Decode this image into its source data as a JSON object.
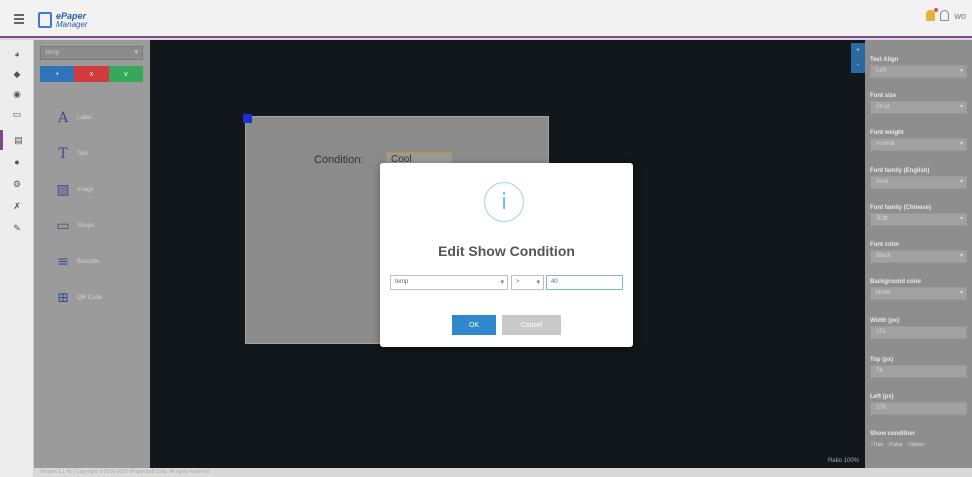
{
  "app": {
    "logo_line1": "ePaper",
    "logo_line2": "Manager",
    "user_label": "wo"
  },
  "rail": {
    "icons": [
      "dashboard-icon",
      "tag-icon",
      "globe-icon",
      "monitor-icon",
      "template-icon",
      "users-icon",
      "gear-icon",
      "tools-icon",
      "wrench-icon"
    ]
  },
  "toolbox": {
    "select_value": "temp",
    "buttons": [
      {
        "label": "+",
        "color": "#2f73b9"
      },
      {
        "label": "x",
        "color": "#d23b3b"
      },
      {
        "label": "v",
        "color": "#36a85a"
      }
    ],
    "tools": [
      {
        "icon": "A",
        "label": "Label"
      },
      {
        "icon": "T",
        "label": "Text"
      },
      {
        "icon": "▨",
        "label": "Image"
      },
      {
        "icon": "▭",
        "label": "Shape"
      },
      {
        "icon": "≡",
        "label": "Barcode"
      },
      {
        "icon": "⊞",
        "label": "QR Code"
      }
    ]
  },
  "canvas": {
    "condition_label": "Condition:",
    "condition_value": "Cool",
    "zoom_label": "Ratio 100%",
    "side_buttons": [
      "+",
      "-"
    ]
  },
  "modal": {
    "icon": "i",
    "title": "Edit Show Condition",
    "field1": "temp",
    "field2": ">",
    "field3": "40",
    "ok_label": "OK",
    "cancel_label": "Cancel"
  },
  "properties": {
    "text_align": {
      "label": "Text Align",
      "value": "Left"
    },
    "font_size": {
      "label": "Font size",
      "value": "24 pt"
    },
    "font_weight": {
      "label": "Font weight",
      "value": "normal"
    },
    "font_family_en": {
      "label": "Font family (English)",
      "value": "Arial"
    },
    "font_family_cn": {
      "label": "Font family (Chinese)",
      "value": "宋体"
    },
    "font_color": {
      "label": "Font color",
      "value": "Black"
    },
    "bg_color": {
      "label": "Background color",
      "value": "None"
    },
    "width": {
      "label": "Width (px)",
      "value": "151"
    },
    "top": {
      "label": "Top (px)",
      "value": "76"
    },
    "left": {
      "label": "Left (px)",
      "value": "379"
    },
    "show_condition": {
      "label": "Show condition",
      "options": [
        "True",
        "False",
        "Option"
      ]
    }
  },
  "footer": "Version 1.1.45 | Copyright © 2016-2020 ePaperSoft Corp. All rights reserved"
}
